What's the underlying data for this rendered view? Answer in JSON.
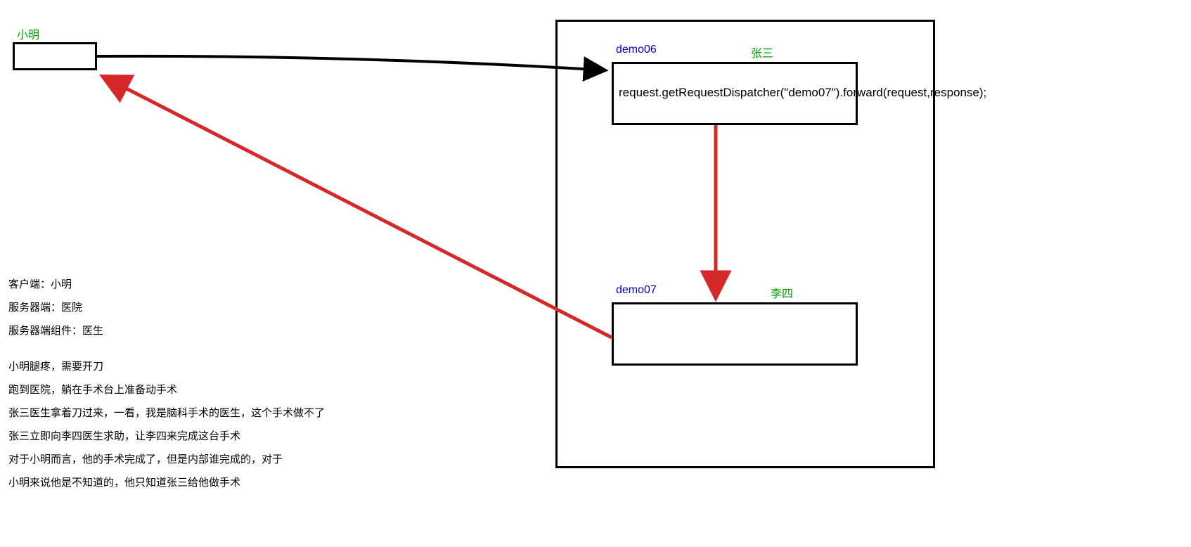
{
  "client": {
    "label": "小明"
  },
  "server": {
    "demo06": {
      "id": "demo06",
      "name": "张三",
      "code": "request.getRequestDispatcher(\"demo07\").forward(request,response);"
    },
    "demo07": {
      "id": "demo07",
      "name": "李四"
    }
  },
  "legend": {
    "client_role": "客户端：小明",
    "server_role": "服务器端：医院",
    "component_role": "服务器端组件：医生"
  },
  "story": {
    "line1": "小明腿疼，需要开刀",
    "line2": "跑到医院，躺在手术台上准备动手术",
    "line3": "张三医生拿着刀过来，一看，我是脑科手术的医生，这个手术做不了",
    "line4": "张三立即向李四医生求助，让李四来完成这台手术",
    "line5": "对于小明而言，他的手术完成了，但是内部谁完成的，对于",
    "line6": "小明来说他是不知道的，他只知道张三给他做手术"
  },
  "colors": {
    "arrow_request": "#000000",
    "arrow_response": "#d62828",
    "label_green": "#00a000",
    "label_blue": "#0000cc"
  }
}
